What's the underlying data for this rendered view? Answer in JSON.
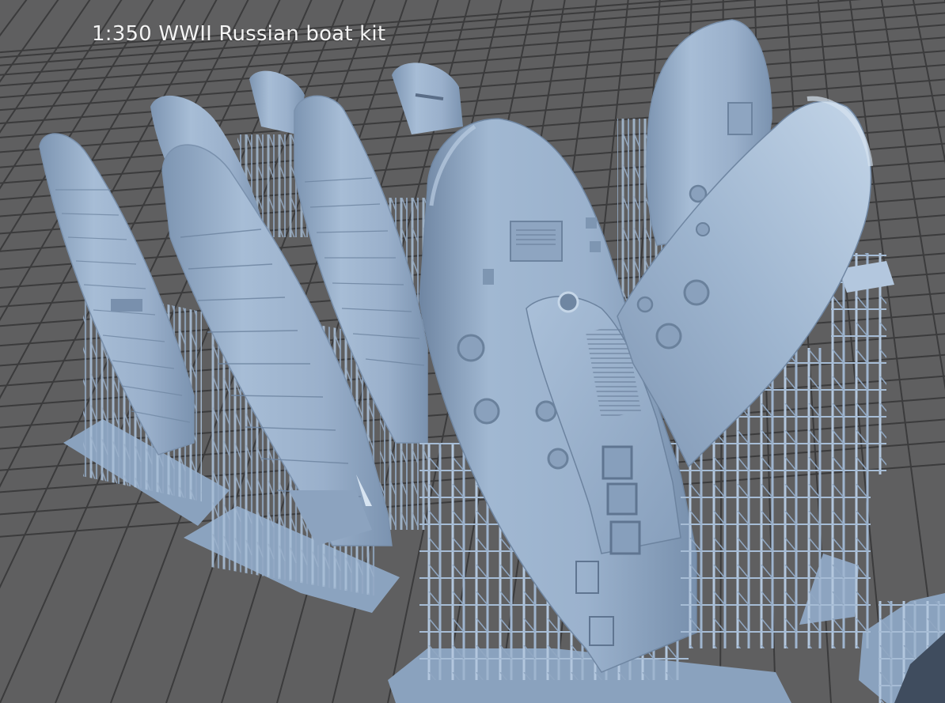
{
  "viewport": {
    "title": "1:350 WWII Russian boat kit"
  },
  "colors": {
    "background": "#5f5f60",
    "grid_line": "#3b3b3c",
    "model_base": "#8fa7c2",
    "model_light": "#b9cde2",
    "model_dark": "#6f86a2",
    "support": "#a3b9d2",
    "raft": "#8da4bf"
  }
}
